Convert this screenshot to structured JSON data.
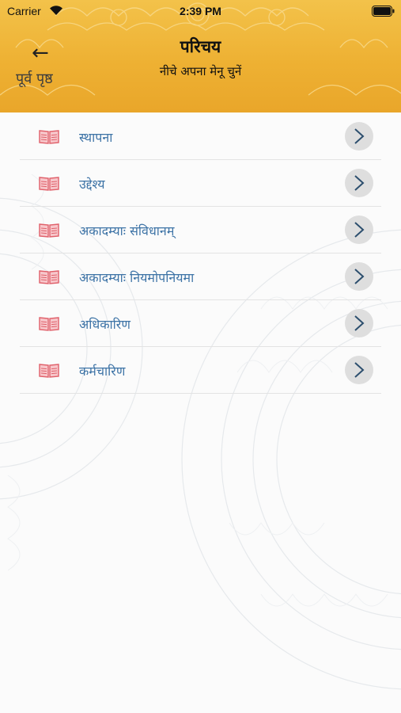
{
  "status_bar": {
    "carrier": "Carrier",
    "time": "2:39 PM"
  },
  "header": {
    "back_arrow": "←",
    "back_label": "पूर्व पृष्ठ",
    "title": "परिचय",
    "subtitle": "नीचे अपना मेनू चुनें"
  },
  "menu": {
    "items": [
      {
        "label": "स्थापना",
        "icon": "book-icon"
      },
      {
        "label": "उद्देश्य",
        "icon": "book-icon"
      },
      {
        "label": "अकादम्याः संविधानम्",
        "icon": "book-icon"
      },
      {
        "label": "अकादम्याः नियमोपनियमा",
        "icon": "book-icon"
      },
      {
        "label": "अधिकारिण",
        "icon": "book-icon"
      },
      {
        "label": "कर्मचारिण",
        "icon": "book-icon"
      }
    ]
  },
  "colors": {
    "header_top": "#f3c24a",
    "header_bottom": "#e9a62a",
    "item_text": "#3d73a6",
    "book_icon": "#e0606a",
    "chevron_bg": "#dedede",
    "chevron_stroke": "#2d4f6e"
  }
}
